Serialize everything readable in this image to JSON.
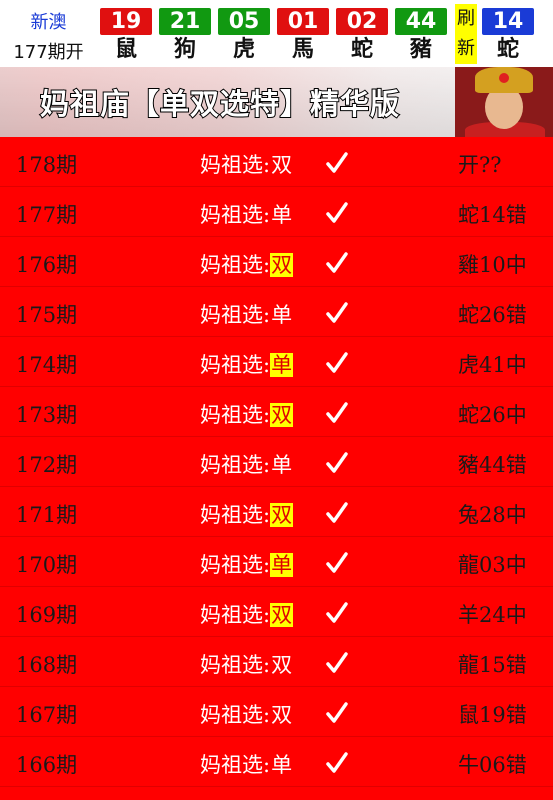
{
  "header": {
    "brand_line1": "新澳",
    "brand_line2": "177期开",
    "balls": [
      {
        "number": "19",
        "zodiac": "鼠",
        "color": "#e01010"
      },
      {
        "number": "21",
        "zodiac": "狗",
        "color": "#119911"
      },
      {
        "number": "05",
        "zodiac": "虎",
        "color": "#119911"
      },
      {
        "number": "01",
        "zodiac": "馬",
        "color": "#e01010"
      },
      {
        "number": "02",
        "zodiac": "蛇",
        "color": "#e01010"
      },
      {
        "number": "44",
        "zodiac": "豬",
        "color": "#119911"
      }
    ],
    "refresh_top": "刷",
    "refresh_bottom": "新",
    "special": {
      "number": "14",
      "zodiac": "蛇",
      "color": "#1a3bd6"
    }
  },
  "banner": {
    "title": "妈祖庙【单双选特】精华版"
  },
  "rows": [
    {
      "period": "178期",
      "label": "妈祖选:",
      "choice": "双",
      "hit": false,
      "result": "开??"
    },
    {
      "period": "177期",
      "label": "妈祖选:",
      "choice": "单",
      "hit": false,
      "result": "蛇14错"
    },
    {
      "period": "176期",
      "label": "妈祖选:",
      "choice": "双",
      "hit": true,
      "result": "雞10中"
    },
    {
      "period": "175期",
      "label": "妈祖选:",
      "choice": "单",
      "hit": false,
      "result": "蛇26错"
    },
    {
      "period": "174期",
      "label": "妈祖选:",
      "choice": "单",
      "hit": true,
      "result": "虎41中"
    },
    {
      "period": "173期",
      "label": "妈祖选:",
      "choice": "双",
      "hit": true,
      "result": "蛇26中"
    },
    {
      "period": "172期",
      "label": "妈祖选:",
      "choice": "单",
      "hit": false,
      "result": "豬44错"
    },
    {
      "period": "171期",
      "label": "妈祖选:",
      "choice": "双",
      "hit": true,
      "result": "兔28中"
    },
    {
      "period": "170期",
      "label": "妈祖选:",
      "choice": "单",
      "hit": true,
      "result": "龍03中"
    },
    {
      "period": "169期",
      "label": "妈祖选:",
      "choice": "双",
      "hit": true,
      "result": "羊24中"
    },
    {
      "period": "168期",
      "label": "妈祖选:",
      "choice": "双",
      "hit": false,
      "result": "龍15错"
    },
    {
      "period": "167期",
      "label": "妈祖选:",
      "choice": "双",
      "hit": false,
      "result": "鼠19错"
    },
    {
      "period": "166期",
      "label": "妈祖选:",
      "choice": "单",
      "hit": false,
      "result": "牛06错"
    }
  ],
  "colors": {
    "page_bg": "#ff0000",
    "hit_highlight": "#ffff00",
    "check": "#ffffff"
  },
  "icons": {
    "check": "check-icon"
  }
}
